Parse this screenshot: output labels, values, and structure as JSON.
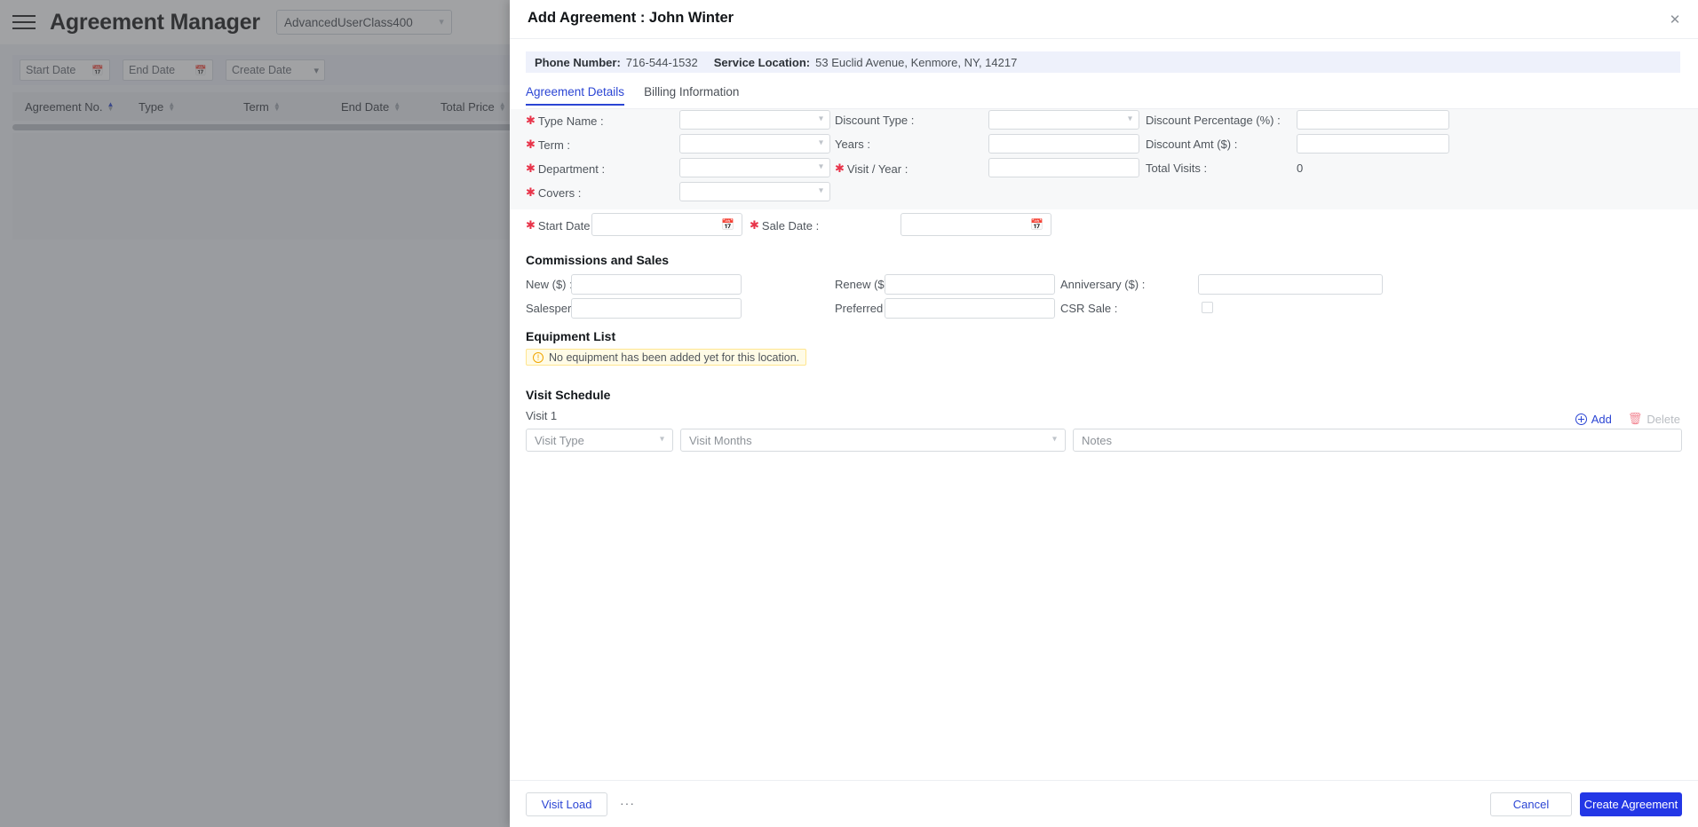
{
  "background": {
    "app_title": "Agreement Manager",
    "user_class": "AdvancedUserClass400",
    "menu_icon": "hamburger-icon",
    "filters": [
      {
        "label": "Start Date",
        "icon": "calendar-icon"
      },
      {
        "label": "End Date",
        "icon": "calendar-icon"
      },
      {
        "label": "Create Date",
        "icon": "chevron-down-icon"
      }
    ],
    "table_columns": [
      "Agreement No.",
      "Type",
      "Term",
      "End Date",
      "Total Price"
    ]
  },
  "modal": {
    "title": "Add Agreement : John Winter",
    "close_icon": "close-icon",
    "info": {
      "phone_label": "Phone Number:",
      "phone_value": "716-544-1532",
      "location_label": "Service Location:",
      "location_value": "53 Euclid Avenue, Kenmore, NY, 14217"
    },
    "tabs": [
      {
        "label": "Agreement Details",
        "active": true
      },
      {
        "label": "Billing Information",
        "active": false
      }
    ],
    "fields": {
      "type_name": {
        "label": "Type Name :",
        "value": "",
        "required": true
      },
      "term": {
        "label": "Term :",
        "value": "",
        "required": true
      },
      "department": {
        "label": "Department :",
        "value": "",
        "required": true
      },
      "covers": {
        "label": "Covers :",
        "value": "",
        "required": true
      },
      "discount_type": {
        "label": "Discount Type :",
        "value": "",
        "required": false
      },
      "years": {
        "label": "Years :",
        "value": "",
        "required": false
      },
      "visit_year": {
        "label": "Visit / Year :",
        "value": "",
        "required": true
      },
      "discount_percentage": {
        "label": "Discount Percentage (%) :",
        "value": "",
        "required": false
      },
      "discount_amt": {
        "label": "Discount Amt ($) :",
        "value": "",
        "required": false
      },
      "total_visits": {
        "label": "Total Visits :",
        "value": "0",
        "required": false
      },
      "start_date": {
        "label": "Start Date :",
        "value": "",
        "required": true,
        "icon": "calendar-icon"
      },
      "sale_date": {
        "label": "Sale Date :",
        "value": "",
        "required": true,
        "icon": "calendar-icon"
      }
    },
    "commissions": {
      "title": "Commissions and Sales",
      "new": {
        "label": "New ($) :",
        "value": ""
      },
      "renew": {
        "label": "Renew ($) :",
        "value": ""
      },
      "anniversary": {
        "label": "Anniversary ($) :",
        "value": ""
      },
      "salesperson": {
        "label": "Salesperson :",
        "value": ""
      },
      "preferred_technician": {
        "label": "Preferred Technician :",
        "value": ""
      },
      "csr_sale": {
        "label": "CSR Sale :",
        "checked": false
      }
    },
    "equipment": {
      "title": "Equipment List",
      "empty_message": "No equipment has been added yet for this location.",
      "warn_icon": "info-circle-icon"
    },
    "visit_schedule": {
      "title": "Visit Schedule",
      "visit_label": "Visit 1",
      "add_label": "Add",
      "add_icon": "plus-circle-icon",
      "delete_label": "Delete",
      "delete_icon": "trash-icon",
      "visit_type_placeholder": "Visit Type",
      "visit_months_placeholder": "Visit Months",
      "notes_placeholder": "Notes"
    },
    "footer": {
      "visit_load": "Visit Load",
      "more": "···",
      "cancel": "Cancel",
      "create": "Create Agreement"
    }
  },
  "colors": {
    "accent": "#2337e6",
    "link": "#2b45d4",
    "required": "#e8344a",
    "warn_bg": "#fffbe6",
    "warn_border": "#ffe58f"
  }
}
